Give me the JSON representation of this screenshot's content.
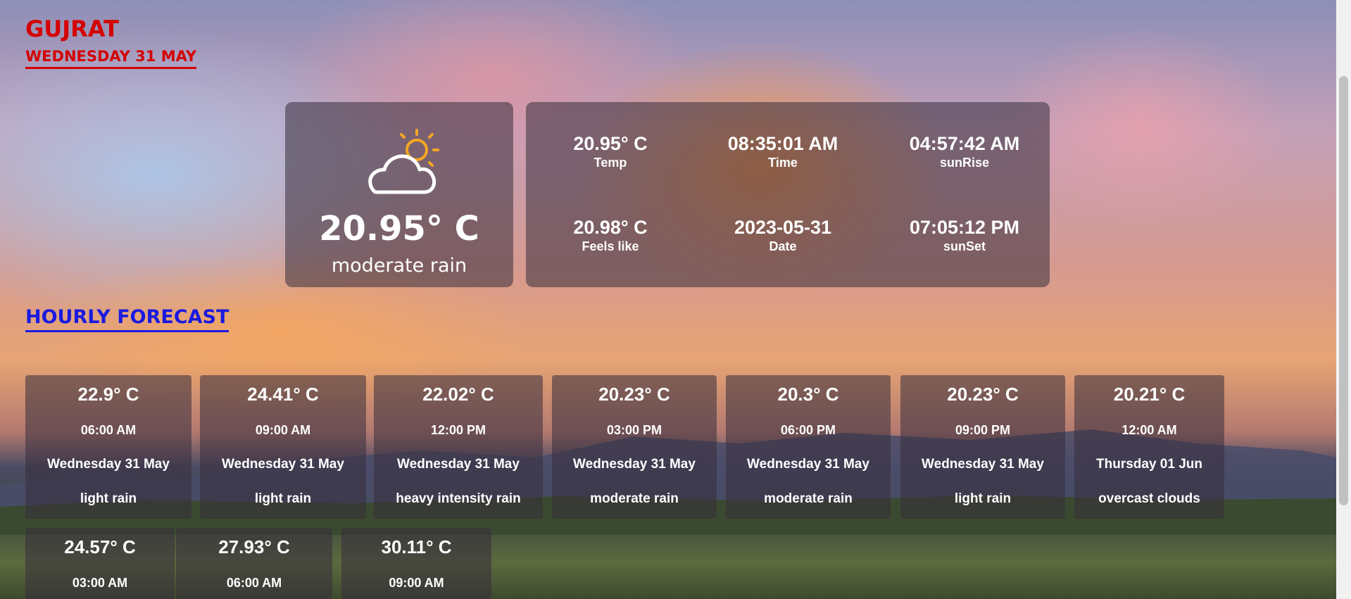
{
  "location": {
    "city": "GUJRAT",
    "date": "WEDNESDAY 31 MAY"
  },
  "current": {
    "icon": "partly-cloudy-icon",
    "temp": "20.95° C",
    "description": "moderate rain"
  },
  "details": [
    {
      "value": "20.95° C",
      "label": "Temp"
    },
    {
      "value": "08:35:01 AM",
      "label": "Time"
    },
    {
      "value": "04:57:42 AM",
      "label": "sunRise"
    },
    {
      "value": "20.98° C",
      "label": "Feels like"
    },
    {
      "value": "2023-05-31",
      "label": "Date"
    },
    {
      "value": "07:05:12 PM",
      "label": "sunSet"
    }
  ],
  "hourly": {
    "title": "HOURLY FORECAST",
    "items": [
      {
        "temp": "22.9° C",
        "time": "06:00 AM",
        "date": "Wednesday 31 May",
        "desc": "light rain"
      },
      {
        "temp": "24.41° C",
        "time": "09:00 AM",
        "date": "Wednesday 31 May",
        "desc": "light rain"
      },
      {
        "temp": "22.02° C",
        "time": "12:00 PM",
        "date": "Wednesday 31 May",
        "desc": "heavy intensity rain"
      },
      {
        "temp": "20.23° C",
        "time": "03:00 PM",
        "date": "Wednesday 31 May",
        "desc": "moderate rain"
      },
      {
        "temp": "20.3° C",
        "time": "06:00 PM",
        "date": "Wednesday 31 May",
        "desc": "moderate rain"
      },
      {
        "temp": "20.23° C",
        "time": "09:00 PM",
        "date": "Wednesday 31 May",
        "desc": "light rain"
      },
      {
        "temp": "20.21° C",
        "time": "12:00 AM",
        "date": "Thursday 01 Jun",
        "desc": "overcast clouds"
      },
      {
        "temp": "24.57° C",
        "time": "03:00 AM"
      },
      {
        "temp": "27.93° C",
        "time": "06:00 AM"
      },
      {
        "temp": "30.11° C",
        "time": "09:00 AM"
      }
    ]
  },
  "colors": {
    "city": "#d40000",
    "hourly_title": "#1a1ae0",
    "icon_sun": "#f5a623"
  }
}
